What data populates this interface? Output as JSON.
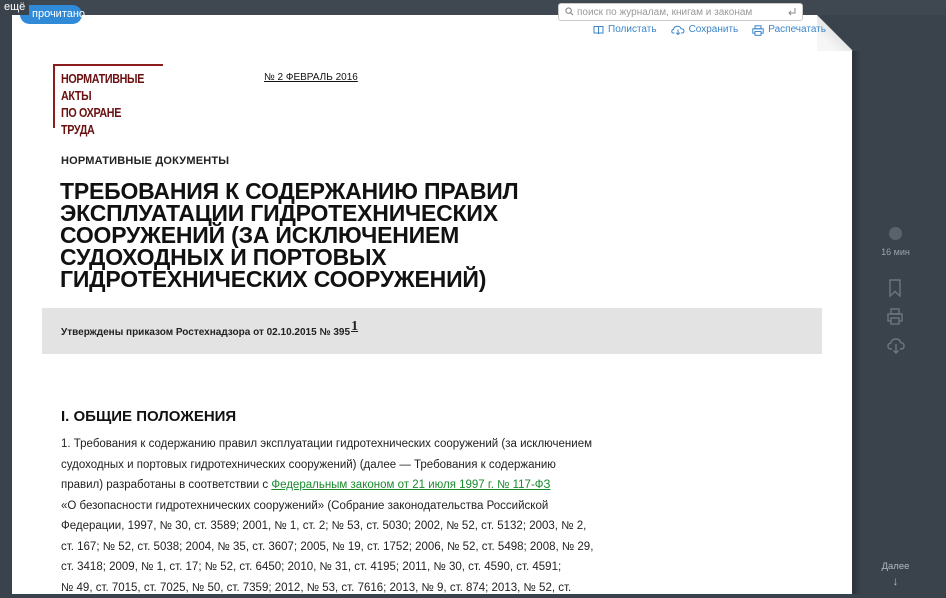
{
  "topbar": {
    "more_label": "ещё",
    "read_label": "прочитано",
    "search_placeholder": "поиск по журналам, книгам и законам",
    "actions": [
      {
        "label": "Полистать",
        "icon": "book-icon"
      },
      {
        "label": "Сохранить",
        "icon": "cloud-download-icon"
      },
      {
        "label": "Распечатать",
        "icon": "printer-icon"
      }
    ]
  },
  "document": {
    "logo_text": "НОРМАТИВНЫЕ АКТЫ\nПО ОХРАНЕ\nТРУДА",
    "issue": "№ 2 ФЕВРАЛЬ 2016",
    "section": "НОРМАТИВНЫЕ ДОКУМЕНТЫ",
    "title": "ТРЕБОВАНИЯ К СОДЕРЖАНИЮ ПРАВИЛ ЭКСПЛУАТАЦИИ ГИДРОТЕХНИЧЕСКИХ СООРУЖЕНИЙ (ЗА ИСКЛЮЧЕНИЕМ СУДОХОДНЫХ И ПОРТОВЫХ ГИДРОТЕХНИЧЕСКИХ СООРУЖЕНИЙ)",
    "approved": "Утверждены приказом Ростехнадзора от 02.10.2015 № 395",
    "footnote": "1",
    "heading": "I. ОБЩИЕ ПОЛОЖЕНИЯ",
    "para_lines": [
      "1. Требования к содержанию правил эксплуатации гидротехнических сооружений (за исключением",
      "судоходных и портовых гидротехнических сооружений) (далее — Требования к содержанию",
      "правил) разработаны в соответствии с ",
      "«О безопасности гидротехнических сооружений» (Собрание законодательства Российской",
      "Федерации, 1997, № 30, ст. 3589; 2001, № 1, ст. 2; № 53, ст. 5030; 2002, № 52, ст. 5132; 2003, № 2,",
      "ст. 167; № 52, ст. 5038; 2004, № 35, ст. 3607; 2005, № 19, ст. 1752; 2006, № 52, ст. 5498; 2008, № 29,",
      "ст. 3418; 2009, № 1, ст. 17; № 52, ст. 6450; 2010, № 31, ст. 4195; 2011, № 30, ст. 4590, ст. 4591;",
      "№ 49, ст. 7015, ст. 7025, № 50, ст. 7359; 2012, № 53, ст. 7616; 2013, № 9, ст. 874; 2013, № 52, ст."
    ],
    "law_link": "Федеральным законом от 21 июля 1997 г. № 117-ФЗ"
  },
  "rail": {
    "time": "16 мин",
    "next_label": "Далее",
    "next_arrow": "↓"
  },
  "colors": {
    "background": "#3a434b",
    "accent": "#3b86c9",
    "pill": "#2f8ad8",
    "logo": "#8a1c1c",
    "link": "#1a8a2e"
  }
}
